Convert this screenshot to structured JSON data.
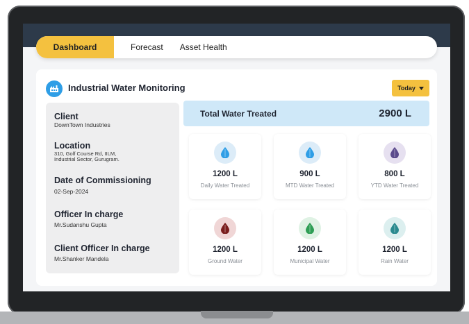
{
  "tabs": [
    {
      "label": "Dashboard",
      "active": true
    },
    {
      "label": "Forecast",
      "active": false
    },
    {
      "label": "Asset Health",
      "active": false
    }
  ],
  "header": {
    "title": "Industrial Water Monitoring",
    "icon": "factory-icon",
    "filter": "Today"
  },
  "info": {
    "client_label": "Client",
    "client_value": "DownTown Industries",
    "location_label": "Location",
    "location_value_1": "310, Golf Course Rd, IILM,",
    "location_value_2": "Industrial Sector, Gurugram.",
    "date_label": "Date of Commissioning",
    "date_value": "02-Sep-2024",
    "officer_label": "Officer In charge",
    "officer_value": "Mr.Sudanshu Gupta",
    "client_officer_label": "Client Officer In charge",
    "client_officer_value": "Mr.Shanker Mandela"
  },
  "total": {
    "label": "Total Water Treated",
    "value": "2900 L"
  },
  "tiles": [
    {
      "value": "1200 L",
      "label": "Daily Water Treated",
      "icon": "water-drop-icon",
      "bg": "#dcecf8",
      "color": "#2f9ee6"
    },
    {
      "value": "900 L",
      "label": "MTD Water Treated",
      "icon": "water-drop-icon",
      "bg": "#dcecf8",
      "color": "#2f9ee6"
    },
    {
      "value": "800 L",
      "label": "YTD Water Treated",
      "icon": "water-drop-icon",
      "bg": "#e6e0f0",
      "color": "#5b4a8c"
    },
    {
      "value": "1200 L",
      "label": "Ground Water",
      "icon": "water-drop-icon",
      "bg": "#f0d6d6",
      "color": "#7a1e1e"
    },
    {
      "value": "1200 L",
      "label": "Municipal Water",
      "icon": "water-drop-icon",
      "bg": "#dff2e4",
      "color": "#2e9e55"
    },
    {
      "value": "1200 L",
      "label": "Rain Water",
      "icon": "water-drop-icon",
      "bg": "#dcefef",
      "color": "#2a8a8f"
    }
  ],
  "colors": {
    "accent": "#f4c13f",
    "primary_blue": "#2f9ee6",
    "total_bg": "#cfe8f8"
  }
}
